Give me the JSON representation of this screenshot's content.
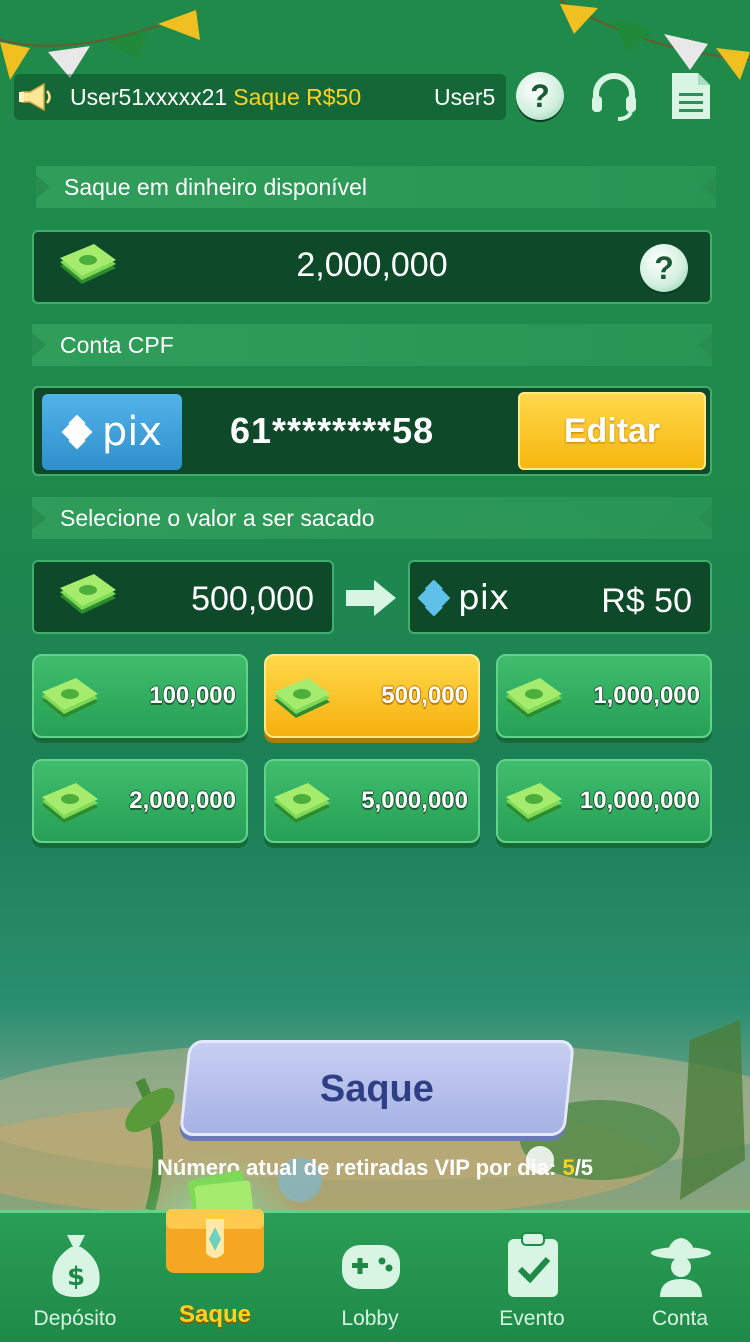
{
  "header": {
    "marquee_user": "User51xxxxx21",
    "marquee_amount": "Saque R$50",
    "marquee_next_user": "User5"
  },
  "balance_section": {
    "title": "Saque em dinheiro disponível",
    "value": "2,000,000",
    "help": "?"
  },
  "account_section": {
    "title": "Conta CPF",
    "pix_label": "pix",
    "cpf_masked": "61********58",
    "edit_label": "Editar"
  },
  "amount_section": {
    "title": "Selecione o valor a ser sacado",
    "selected_amount": "500,000",
    "pix_label": "pix",
    "reais_value": "R$ 50"
  },
  "options": [
    {
      "label": "100,000",
      "selected": false
    },
    {
      "label": "500,000",
      "selected": true
    },
    {
      "label": "1,000,000",
      "selected": false
    },
    {
      "label": "2,000,000",
      "selected": false
    },
    {
      "label": "5,000,000",
      "selected": false
    },
    {
      "label": "10,000,000",
      "selected": false
    }
  ],
  "withdraw": {
    "button_label": "Saque",
    "vip_text": "Número atual de retiradas VIP por dia: ",
    "vip_current": "5",
    "vip_max": "/5"
  },
  "nav": {
    "items": [
      {
        "label": "Depósito",
        "icon": "money-bag-icon"
      },
      {
        "label": "Saque",
        "icon": "wallet-icon",
        "active": true
      },
      {
        "label": "Lobby",
        "icon": "gamepad-icon"
      },
      {
        "label": "Evento",
        "icon": "clipboard-check-icon"
      },
      {
        "label": "Conta",
        "icon": "user-sombrero-icon"
      }
    ]
  },
  "colors": {
    "background": "#1f8a4a",
    "accent_yellow": "#ffd21f",
    "button_lavender": "#a6b1e4",
    "pix_blue": "#2f8fcc"
  }
}
